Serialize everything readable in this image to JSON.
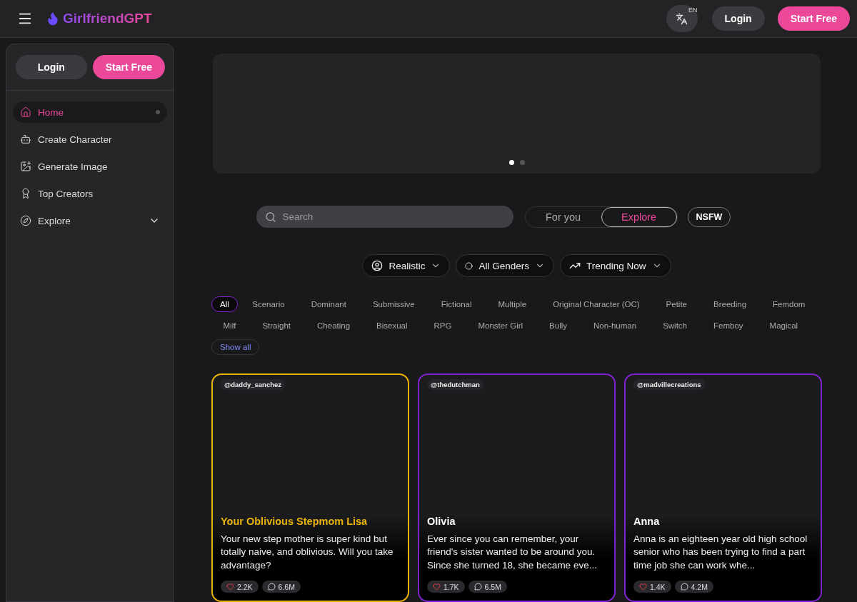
{
  "header": {
    "logo": "GirlfriendGPT",
    "language": "EN",
    "login": "Login",
    "start": "Start Free"
  },
  "sidebar": {
    "login": "Login",
    "start": "Start Free",
    "items": [
      {
        "label": "Home",
        "kind": "link",
        "selected": true
      },
      {
        "label": "Create Character",
        "kind": "link",
        "selected": false
      },
      {
        "label": "Generate Image",
        "kind": "link",
        "selected": false
      },
      {
        "label": "Top Creators",
        "kind": "link",
        "selected": false
      },
      {
        "label": "Explore",
        "kind": "dropdown",
        "selected": false
      }
    ]
  },
  "banner": {
    "dots": [
      {
        "selected": true
      },
      {
        "selected": false
      }
    ]
  },
  "search": {
    "placeholder": "Search"
  },
  "tabs": [
    {
      "label": "For you",
      "selected": false
    },
    {
      "label": "Explore",
      "selected": true
    }
  ],
  "nsfw": "NSFW",
  "filters": [
    {
      "label": "Realistic"
    },
    {
      "label": "All Genders"
    },
    {
      "label": "Trending Now"
    }
  ],
  "tags": [
    {
      "label": "All",
      "selected": true
    },
    {
      "label": "Scenario",
      "selected": false
    },
    {
      "label": "Dominant",
      "selected": false
    },
    {
      "label": "Submissive",
      "selected": false
    },
    {
      "label": "Fictional",
      "selected": false
    },
    {
      "label": "Multiple",
      "selected": false
    },
    {
      "label": "Original Character (OC)",
      "selected": false
    },
    {
      "label": "Petite",
      "selected": false
    },
    {
      "label": "Breeding",
      "selected": false
    },
    {
      "label": "Femdom",
      "selected": false
    },
    {
      "label": "Milf",
      "selected": false
    },
    {
      "label": "Straight",
      "selected": false
    },
    {
      "label": "Cheating",
      "selected": false
    },
    {
      "label": "Bisexual",
      "selected": false
    },
    {
      "label": "RPG",
      "selected": false
    },
    {
      "label": "Monster Girl",
      "selected": false
    },
    {
      "label": "Bully",
      "selected": false
    },
    {
      "label": "Non-human",
      "selected": false
    },
    {
      "label": "Switch",
      "selected": false
    },
    {
      "label": "Femboy",
      "selected": false
    },
    {
      "label": "Magical",
      "selected": false
    }
  ],
  "show_all": "Show all",
  "cards": [
    {
      "creator": "@daddy_sanchez",
      "title": "Your Oblivious Stepmom Lisa",
      "color": "#eab308",
      "description": "Your new step mother is super kind but totally naive, and oblivious. Will you take advantage?",
      "likes": "2.2K",
      "chats": "6.6M"
    },
    {
      "creator": "@thedutchman",
      "title": "Olivia",
      "color": "#7e22ce",
      "description": "Ever since you can remember, your friend's sister wanted to be around you. Since she turned 18, she became eve...",
      "likes": "1.7K",
      "chats": "6.5M"
    },
    {
      "creator": "@madvillecreations",
      "title": "Anna",
      "color": "#7e22ce",
      "description": "Anna is an eighteen year old high school senior who has been trying to find a part time job she can work whe...",
      "likes": "1.4K",
      "chats": "4.2M"
    }
  ]
}
